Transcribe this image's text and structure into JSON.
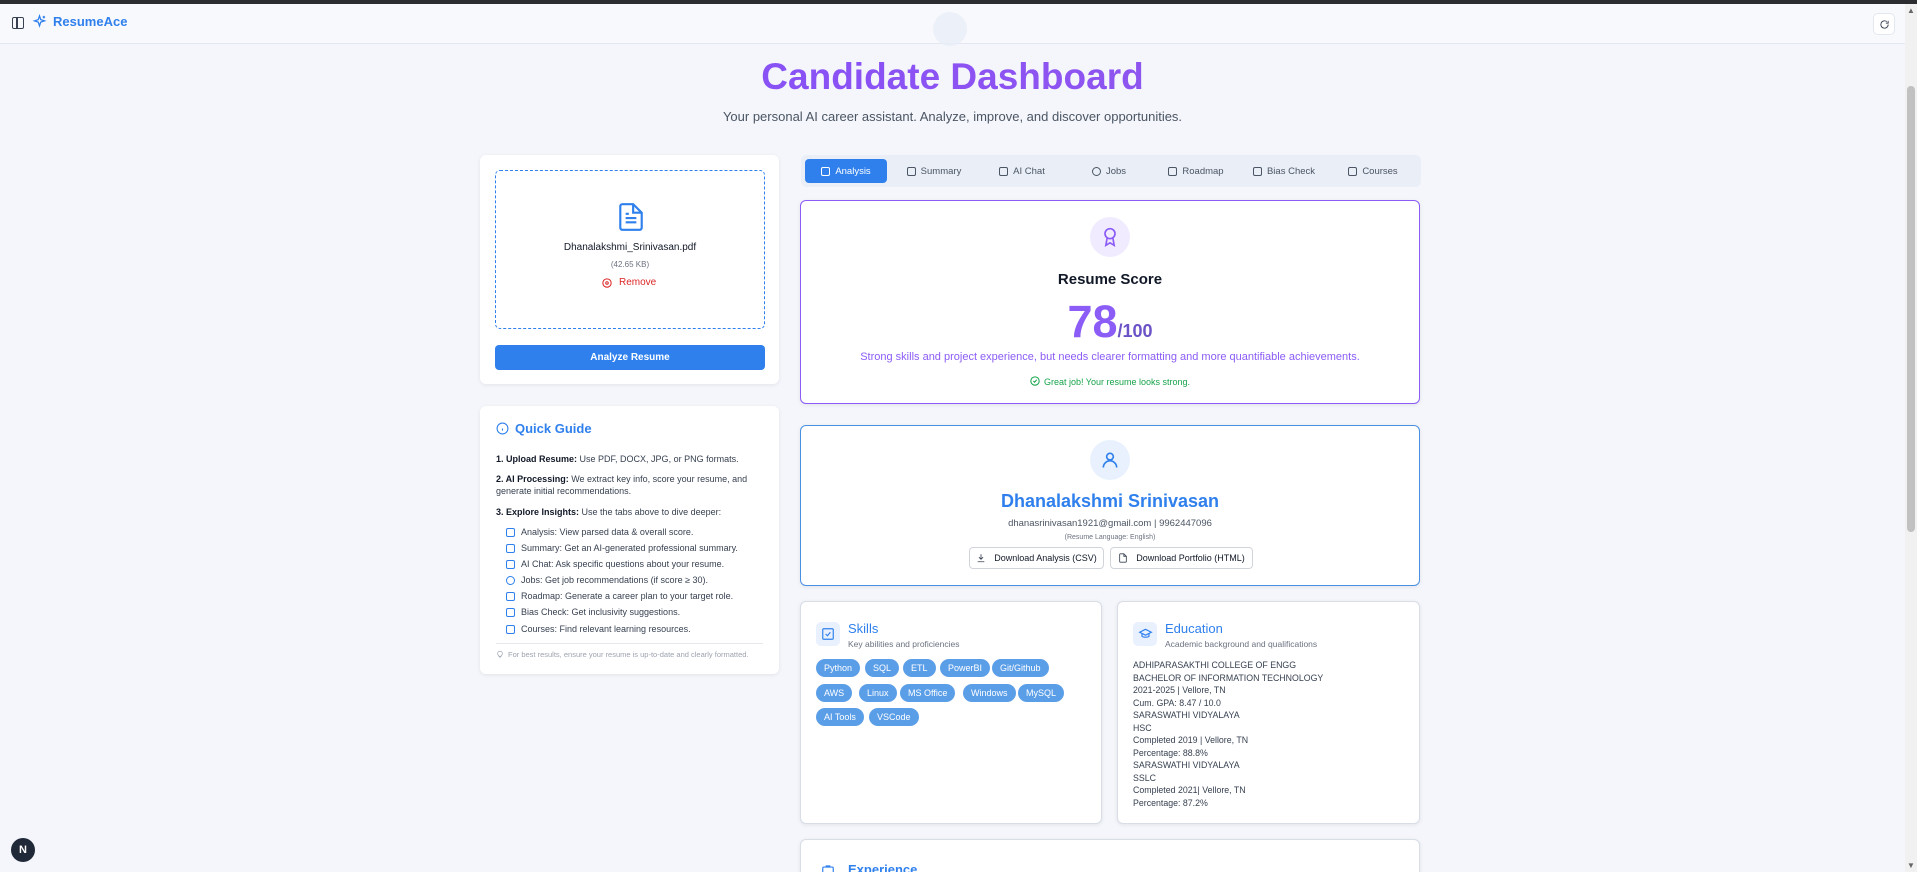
{
  "app": {
    "brand": "ResumeAce"
  },
  "header": {
    "title": "Candidate Dashboard",
    "subtitle": "Your personal AI career assistant. Analyze, improve, and discover opportunities."
  },
  "upload": {
    "file_name": "Dhanalakshmi_Srinivasan.pdf",
    "file_size": "(42.65 KB)",
    "remove_label": "Remove",
    "analyze_label": "Analyze Resume"
  },
  "guide": {
    "title": "Quick Guide",
    "steps": [
      {
        "label": "1. Upload Resume:",
        "text": "Use PDF, DOCX, JPG, or PNG formats."
      },
      {
        "label": "2. AI Processing:",
        "text": "We extract key info, score your resume, and generate initial recommendations."
      },
      {
        "label": "3. Explore Insights:",
        "text": "Use the tabs above to dive deeper:"
      }
    ],
    "items": [
      "Analysis: View parsed data & overall score.",
      "Summary: Get an AI-generated professional summary.",
      "AI Chat: Ask specific questions about your resume.",
      "Jobs: Get job recommendations (if score ≥ 30).",
      "Roadmap: Generate a career plan to your target role.",
      "Bias Check: Get inclusivity suggestions.",
      "Courses: Find relevant learning resources."
    ],
    "tip": "For best results, ensure your resume is up-to-date and clearly formatted."
  },
  "tabs": [
    "Analysis",
    "Summary",
    "AI Chat",
    "Jobs",
    "Roadmap",
    "Bias Check",
    "Courses"
  ],
  "active_tab": "Analysis",
  "score": {
    "title": "Resume Score",
    "value": "78",
    "max": "/100",
    "summary": "Strong skills and project experience, but needs clearer formatting and more quantifiable achievements.",
    "verdict": "Great job! Your resume looks strong."
  },
  "profile": {
    "name": "Dhanalakshmi Srinivasan",
    "contact": "dhanasrinivasan1921@gmail.com | 9962447096",
    "language": "(Resume Language: English)",
    "download_csv": "Download Analysis (CSV)",
    "download_html": "Download Portfolio (HTML)"
  },
  "skills": {
    "title": "Skills",
    "subtitle": "Key abilities and proficiencies",
    "items": [
      "Python",
      "SQL",
      "ETL",
      "PowerBI",
      "Git/Github",
      "AWS",
      "Linux",
      "MS Office",
      "Windows",
      "MySQL",
      "AI Tools",
      "VSCode"
    ]
  },
  "education": {
    "title": "Education",
    "subtitle": "Academic background and qualifications",
    "lines": [
      "ADHIPARASAKTHI COLLEGE OF ENGG",
      "BACHELOR OF INFORMATION TECHNOLOGY",
      "2021-2025 | Vellore, TN",
      "Cum. GPA: 8.47 / 10.0",
      "SARASWATHI VIDYALAYA",
      "HSC",
      "Completed 2019 | Vellore, TN",
      "Percentage: 88.8%",
      "SARASWATHI VIDYALAYA",
      "SSLC",
      "Completed 2021| Vellore, TN",
      "Percentage: 87.2%"
    ]
  },
  "experience": {
    "title": "Experience"
  },
  "colors": {
    "accent": "#2f80ed",
    "score": "#8b5cf6",
    "success": "#16a34a",
    "danger": "#dc2626"
  },
  "misc": {
    "next_badge": "N"
  }
}
